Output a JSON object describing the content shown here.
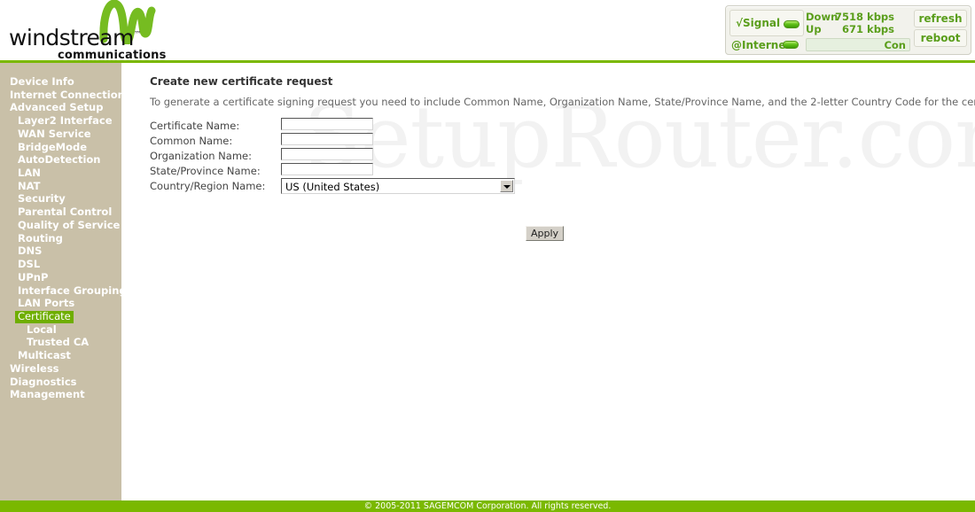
{
  "brand": {
    "name": "windstream",
    "trademark": "™",
    "tagline": "communications",
    "wave_icon": "windstream-wave-icon",
    "accent_green": "#7ab800",
    "sidebar_tan": "#c9c0a8",
    "selected_green": "#6fae00"
  },
  "status": {
    "signal_label": "√Signal",
    "signal_led": "green-led",
    "internet_label": "@Internet",
    "internet_led": "green-led",
    "down_label": "Down",
    "down_value": "7518 kbps",
    "up_label": "Up",
    "up_value": "671 kbps",
    "connection_state": "Con",
    "refresh_label": "refresh",
    "reboot_label": "reboot"
  },
  "sidebar": {
    "items": [
      {
        "label": "Device Info",
        "level": 0,
        "selected": false
      },
      {
        "label": "Internet Connection",
        "level": 0,
        "selected": false
      },
      {
        "label": "Advanced Setup",
        "level": 0,
        "selected": false
      },
      {
        "label": "Layer2 Interface",
        "level": 1,
        "selected": false
      },
      {
        "label": "WAN Service",
        "level": 1,
        "selected": false
      },
      {
        "label": "BridgeMode",
        "level": 1,
        "selected": false
      },
      {
        "label": "AutoDetection",
        "level": 1,
        "selected": false
      },
      {
        "label": "LAN",
        "level": 1,
        "selected": false
      },
      {
        "label": "NAT",
        "level": 1,
        "selected": false
      },
      {
        "label": "Security",
        "level": 1,
        "selected": false
      },
      {
        "label": "Parental Control",
        "level": 1,
        "selected": false
      },
      {
        "label": "Quality of Service",
        "level": 1,
        "selected": false
      },
      {
        "label": "Routing",
        "level": 1,
        "selected": false
      },
      {
        "label": "DNS",
        "level": 1,
        "selected": false
      },
      {
        "label": "DSL",
        "level": 1,
        "selected": false
      },
      {
        "label": "UPnP",
        "level": 1,
        "selected": false
      },
      {
        "label": "Interface Grouping",
        "level": 1,
        "selected": false
      },
      {
        "label": "LAN Ports",
        "level": 1,
        "selected": false
      },
      {
        "label": "Certificate",
        "level": 1,
        "selected": true
      },
      {
        "label": "Local",
        "level": 2,
        "selected": false
      },
      {
        "label": "Trusted CA",
        "level": 2,
        "selected": false
      },
      {
        "label": "Multicast",
        "level": 1,
        "selected": false
      },
      {
        "label": "Wireless",
        "level": 0,
        "selected": false
      },
      {
        "label": "Diagnostics",
        "level": 0,
        "selected": false
      },
      {
        "label": "Management",
        "level": 0,
        "selected": false
      }
    ]
  },
  "content": {
    "watermark": "SetupRouter.com",
    "title": "Create new certificate request",
    "description": "To generate a certificate signing request you need to include Common Name, Organization Name, State/Province Name, and the 2-letter Country Code for the certificate.",
    "fields": [
      {
        "label": "Certificate Name:",
        "value": "",
        "placeholder": "",
        "type": "text"
      },
      {
        "label": "Common Name:",
        "value": "",
        "placeholder": "",
        "type": "text"
      },
      {
        "label": "Organization Name:",
        "value": "",
        "placeholder": "",
        "type": "text"
      },
      {
        "label": "State/Province Name:",
        "value": "",
        "placeholder": "",
        "type": "text"
      }
    ],
    "country": {
      "label": "Country/Region Name:",
      "selected": "US (United States)",
      "arrow_icon": "chevron-down-icon"
    },
    "apply_label": "Apply"
  },
  "footer": {
    "copyright": "© 2005-2011 SAGEMCOM Corporation. All rights reserved."
  }
}
